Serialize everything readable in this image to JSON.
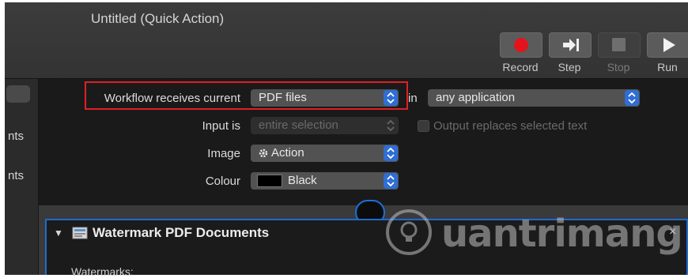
{
  "window": {
    "title": "Untitled (Quick Action)"
  },
  "toolbar": {
    "buttons": [
      {
        "label": "Record",
        "icon": "record-dot-icon",
        "enabled": true
      },
      {
        "label": "Step",
        "icon": "step-arrow-icon",
        "enabled": true
      },
      {
        "label": "Stop",
        "icon": "stop-square-icon",
        "enabled": false
      },
      {
        "label": "Run",
        "icon": "play-triangle-icon",
        "enabled": true
      }
    ]
  },
  "sidebar": {
    "items": [
      "nts",
      "nts"
    ]
  },
  "workflow": {
    "receives_label": "Workflow receives current",
    "receives_value": "PDF files",
    "in_label": "in",
    "in_value": "any application",
    "input_is_label": "Input is",
    "input_is_value": "entire selection",
    "output_replaces_label": "Output replaces selected text",
    "output_replaces_checked": false,
    "image_label": "Image",
    "image_value": "Action",
    "colour_label": "Colour",
    "colour_value": "Black",
    "colour_swatch": "#000000"
  },
  "action": {
    "title": "Watermark PDF Documents",
    "subtitle": "Watermarks:",
    "close_glyph": "×"
  },
  "watermark": {
    "text": "uantrimang"
  },
  "colors": {
    "record": "#e3141b",
    "accent": "#1d6ad1",
    "highlight_frame": "#e01f26"
  }
}
